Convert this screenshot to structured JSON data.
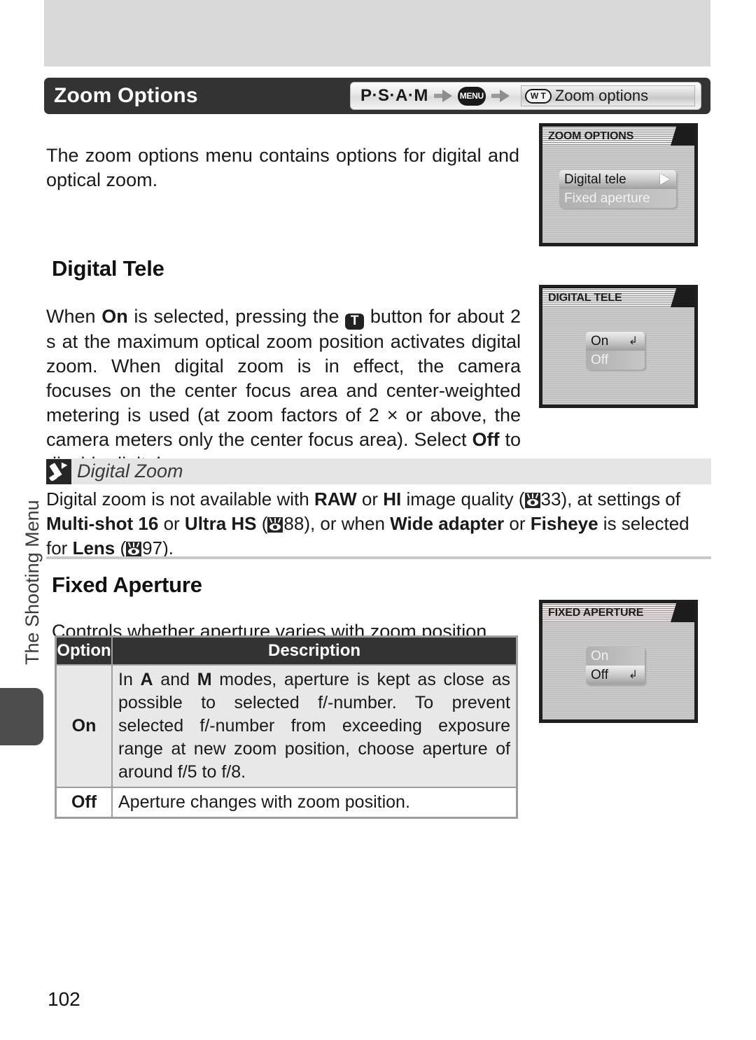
{
  "header": {
    "title": "Zoom Options",
    "breadcrumb": {
      "modes": "P·S·A·M",
      "menu_badge": "MENU",
      "wt_badge": "W T",
      "destination": "Zoom options"
    }
  },
  "sidebar": {
    "running_head": "The Shooting Menu"
  },
  "intro": {
    "text": "The zoom options menu contains options for digital and optical zoom."
  },
  "sections": {
    "digital_tele": {
      "heading": "Digital Tele",
      "p1_a": "When ",
      "p1_on": "On",
      "p1_b": " is selected, pressing the ",
      "p1_tbtn": "T",
      "p1_c": " button for about 2 s at the maximum optical zoom position activates digital zoom.  When digital zoom is in effect, the camera focuses on the center focus area and center-weighted metering is used (at zoom factors of 2 × or above, the camera meters only the center focus area).  Select ",
      "p1_off": "Off",
      "p1_d": " to disable digital zoom."
    },
    "fixed_aperture": {
      "heading": "Fixed Aperture",
      "intro": "Controls whether aperture varies with zoom position."
    }
  },
  "note": {
    "title": "Digital Zoom",
    "a": "Digital zoom is not available with ",
    "raw": "RAW",
    "b": " or ",
    "hi": "HI",
    "c": " image quality (",
    "ref1": "33",
    "d": "), at settings of ",
    "multishot": "Multi-shot 16",
    "e": " or ",
    "ultrahs": "Ultra HS",
    "f": " (",
    "ref2": "88",
    "g": "), or when ",
    "wideadapter": "Wide adapter",
    "h": " or ",
    "fisheye": "Fisheye",
    "i": " is selected for ",
    "lens": "Lens",
    "j": " (",
    "ref3": "97",
    "k": ")."
  },
  "table": {
    "headers": [
      "Option",
      "Description"
    ],
    "rows": [
      {
        "option": "On",
        "desc_a": "In ",
        "desc_A": "A",
        "desc_b": " and ",
        "desc_M": "M",
        "desc_c": " modes, aperture is kept as close as possible to selected f/-number.   To prevent selected f/-number from exceeding exposure range at new zoom position, choose aperture of around f/5 to f/8."
      },
      {
        "option": "Off",
        "desc_c": "Aperture changes with zoom position."
      }
    ]
  },
  "lcd_screens": [
    {
      "id": "zoom-options",
      "title": "ZOOM OPTIONS",
      "items": [
        {
          "label": "Digital tele",
          "state": "selected",
          "indicator": "arrow-right"
        },
        {
          "label": "Fixed aperture",
          "state": "unselected",
          "indicator": "none"
        }
      ]
    },
    {
      "id": "digital-tele",
      "title": "DIGITAL TELE",
      "items": [
        {
          "label": "On",
          "state": "selected",
          "indicator": "enter"
        },
        {
          "label": "Off",
          "state": "unselected",
          "indicator": "none"
        }
      ]
    },
    {
      "id": "fixed-aperture",
      "title": "FIXED APERTURE",
      "items": [
        {
          "label": "On",
          "state": "unselected",
          "indicator": "none"
        },
        {
          "label": "Off",
          "state": "selected",
          "indicator": "enter"
        }
      ]
    }
  ],
  "footer": {
    "page_number": "102"
  },
  "colors": {
    "header_bar": "#333333",
    "top_band": "#d9d9d9",
    "note_head": "#e5e5e5",
    "table_border": "#9d9d9d",
    "table_row_on": "#e8e8e8"
  }
}
